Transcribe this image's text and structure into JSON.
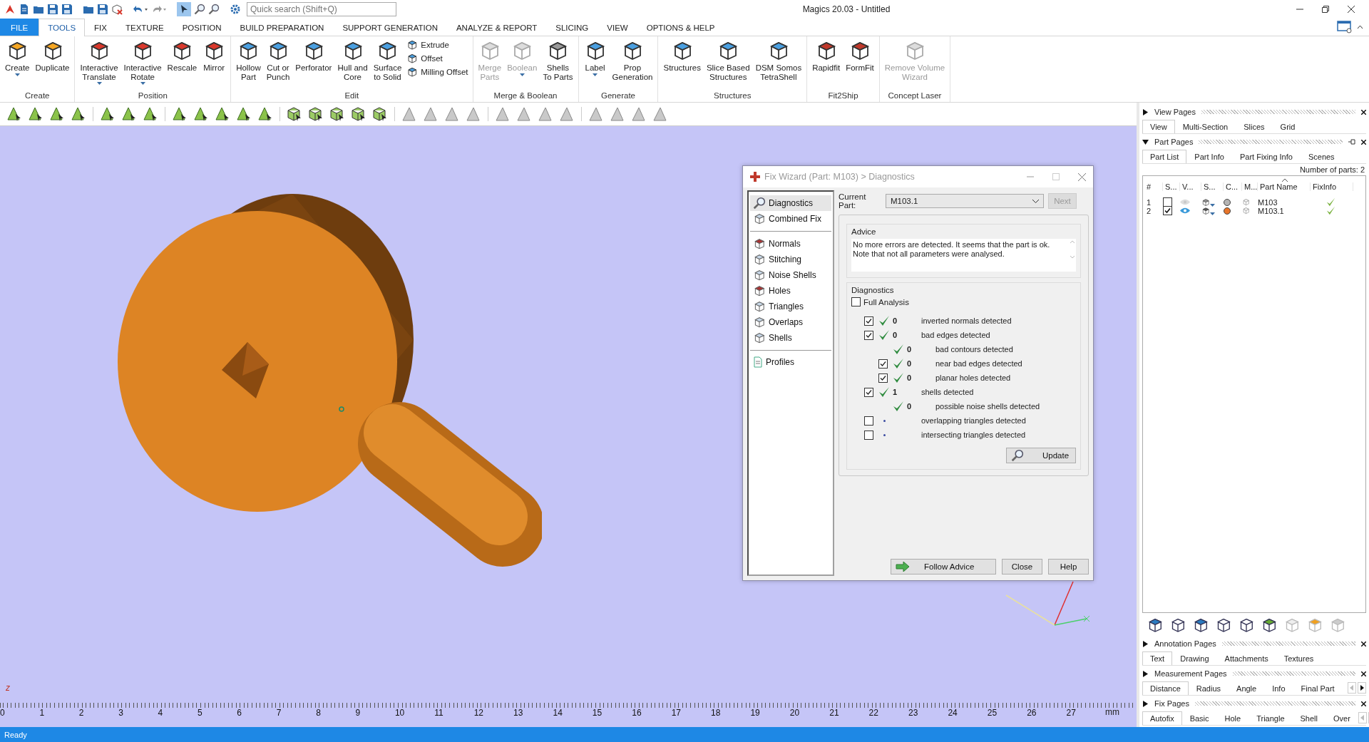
{
  "title_bar": {
    "search": {
      "placeholder": "Quick search (Shift+Q)"
    },
    "title": "Magics 20.03 - Untitled"
  },
  "menu_tabs": [
    {
      "label": "FILE",
      "kind": "file",
      "selected": false
    },
    {
      "label": "TOOLS",
      "kind": "tab",
      "selected": true
    },
    {
      "label": "FIX",
      "kind": "tab",
      "selected": false
    },
    {
      "label": "TEXTURE",
      "kind": "tab",
      "selected": false
    },
    {
      "label": "POSITION",
      "kind": "tab",
      "selected": false
    },
    {
      "label": "BUILD PREPARATION",
      "kind": "tab",
      "selected": false
    },
    {
      "label": "SUPPORT GENERATION",
      "kind": "tab",
      "selected": false
    },
    {
      "label": "ANALYZE & REPORT",
      "kind": "tab",
      "selected": false
    },
    {
      "label": "SLICING",
      "kind": "tab",
      "selected": false
    },
    {
      "label": "VIEW",
      "kind": "tab",
      "selected": false
    },
    {
      "label": "OPTIONS & HELP",
      "kind": "tab",
      "selected": false
    }
  ],
  "ribbon": {
    "groups": [
      {
        "label": "Create",
        "buttons": [
          {
            "label": "Create",
            "kind": "large",
            "dropdown": true,
            "disabled": false
          },
          {
            "label": "Duplicate",
            "kind": "large",
            "dropdown": false,
            "disabled": false
          }
        ]
      },
      {
        "label": "Position",
        "buttons": [
          {
            "label": "Interactive\nTranslate",
            "kind": "large",
            "dropdown": true,
            "disabled": false
          },
          {
            "label": "Interactive\nRotate",
            "kind": "large",
            "dropdown": true,
            "disabled": false
          },
          {
            "label": "Rescale",
            "kind": "large",
            "dropdown": false,
            "disabled": false
          },
          {
            "label": "Mirror",
            "kind": "large",
            "dropdown": false,
            "disabled": false
          }
        ]
      },
      {
        "label": "Edit",
        "buttons": [
          {
            "label": "Hollow\nPart",
            "kind": "large",
            "dropdown": false,
            "disabled": false
          },
          {
            "label": "Cut or\nPunch",
            "kind": "large",
            "dropdown": false,
            "disabled": false
          },
          {
            "label": "Perforator",
            "kind": "large",
            "dropdown": false,
            "disabled": false
          },
          {
            "label": "Hull and\nCore",
            "kind": "large",
            "dropdown": false,
            "disabled": false
          },
          {
            "label": "Surface\nto Solid",
            "kind": "large",
            "dropdown": false,
            "disabled": false
          },
          {
            "label": "Extrude",
            "kind": "small",
            "dropdown": false,
            "disabled": false
          },
          {
            "label": "Offset",
            "kind": "small",
            "dropdown": false,
            "disabled": false
          },
          {
            "label": "Milling Offset",
            "kind": "small",
            "dropdown": false,
            "disabled": false
          }
        ]
      },
      {
        "label": "Merge & Boolean",
        "buttons": [
          {
            "label": "Merge\nParts",
            "kind": "large",
            "dropdown": false,
            "disabled": true
          },
          {
            "label": "Boolean",
            "kind": "large",
            "dropdown": true,
            "disabled": true
          },
          {
            "label": "Shells\nTo Parts",
            "kind": "large",
            "dropdown": false,
            "disabled": false
          }
        ]
      },
      {
        "label": "Generate",
        "buttons": [
          {
            "label": "Label",
            "kind": "large",
            "dropdown": true,
            "disabled": false
          },
          {
            "label": "Prop\nGeneration",
            "kind": "large",
            "dropdown": false,
            "disabled": false
          }
        ]
      },
      {
        "label": "Structures",
        "buttons": [
          {
            "label": "Structures",
            "kind": "large",
            "dropdown": false,
            "disabled": false
          },
          {
            "label": "Slice Based\nStructures",
            "kind": "large",
            "dropdown": false,
            "disabled": false
          },
          {
            "label": "DSM Somos\nTetraShell",
            "kind": "large",
            "dropdown": false,
            "disabled": false
          }
        ]
      },
      {
        "label": "Fit2Ship",
        "buttons": [
          {
            "label": "Rapidfit",
            "kind": "large",
            "dropdown": false,
            "disabled": false
          },
          {
            "label": "FormFit",
            "kind": "large",
            "dropdown": false,
            "disabled": false
          }
        ]
      },
      {
        "label": "Concept Laser",
        "buttons": [
          {
            "label": "Remove Volume\nWizard",
            "kind": "large",
            "dropdown": false,
            "disabled": true
          }
        ]
      }
    ]
  },
  "viewport": {
    "axis_label": "z",
    "ruler": {
      "labels": [
        "0",
        "1",
        "2",
        "3",
        "4",
        "5",
        "6",
        "7",
        "8",
        "9",
        "10",
        "11",
        "12",
        "13",
        "14",
        "15",
        "16",
        "17",
        "18",
        "19",
        "20",
        "21",
        "22",
        "23",
        "24",
        "25",
        "26",
        "27"
      ],
      "unit": "mm"
    }
  },
  "fix_wizard": {
    "title": "Fix Wizard (Part: M103) > Diagnostics",
    "nav_groups": [
      {
        "items": [
          {
            "label": "Diagnostics",
            "selected": true
          },
          {
            "label": "Combined Fix",
            "selected": false
          }
        ]
      },
      {
        "items": [
          {
            "label": "Normals",
            "selected": false
          },
          {
            "label": "Stitching",
            "selected": false
          },
          {
            "label": "Noise Shells",
            "selected": false
          },
          {
            "label": "Holes",
            "selected": false
          },
          {
            "label": "Triangles",
            "selected": false
          },
          {
            "label": "Overlaps",
            "selected": false
          },
          {
            "label": "Shells",
            "selected": false
          }
        ]
      },
      {
        "items": [
          {
            "label": "Profiles",
            "selected": false
          }
        ]
      }
    ],
    "current_part": {
      "label": "Current Part:",
      "value": "M103.1"
    },
    "next_button": {
      "label": "Next",
      "disabled": true
    },
    "advice": {
      "title": "Advice",
      "text": "No more errors are detected. It seems that the part is ok.\nNote that not all parameters were analysed."
    },
    "diagnostics": {
      "title": "Diagnostics",
      "full_analysis": {
        "label": "Full Analysis",
        "checked": false
      },
      "checks": [
        {
          "kind": "check",
          "checked": true,
          "ok": true,
          "count": "0",
          "label": "inverted normals detected"
        },
        {
          "kind": "check",
          "checked": true,
          "ok": true,
          "count": "0",
          "label": "bad edges detected",
          "children": [
            {
              "kind": "plain",
              "ok": true,
              "count": "0",
              "label": "bad contours detected"
            },
            {
              "kind": "check",
              "checked": true,
              "ok": true,
              "count": "0",
              "label": "near bad edges detected"
            },
            {
              "kind": "check",
              "checked": true,
              "ok": true,
              "count": "0",
              "label": "planar holes detected"
            }
          ]
        },
        {
          "kind": "check",
          "checked": true,
          "ok": true,
          "count": "1",
          "label": "shells detected",
          "children": [
            {
              "kind": "plain",
              "ok": true,
              "count": "0",
              "label": "possible noise shells detected"
            }
          ]
        },
        {
          "kind": "check",
          "checked": false,
          "ok": false,
          "label": "overlapping triangles detected"
        },
        {
          "kind": "check",
          "checked": false,
          "ok": false,
          "label": "intersecting triangles detected"
        }
      ]
    },
    "update_button": "Update",
    "buttons": [
      "Follow Advice",
      "Close",
      "Help"
    ]
  },
  "panel_sections": [
    {
      "kind": "tabs",
      "title": "View Pages",
      "expanded": false,
      "scrollable": false,
      "tabs": [
        {
          "label": "View",
          "selected": true
        },
        {
          "label": "Multi-Section",
          "selected": false
        },
        {
          "label": "Slices",
          "selected": false
        },
        {
          "label": "Grid",
          "selected": false
        }
      ]
    },
    {
      "kind": "part_list",
      "title": "Part Pages",
      "expanded": true,
      "scrollable": false,
      "tabs": [
        {
          "label": "Part List",
          "selected": true
        },
        {
          "label": "Part Info",
          "selected": false
        },
        {
          "label": "Part Fixing Info",
          "selected": false
        },
        {
          "label": "Scenes",
          "selected": false
        }
      ],
      "parts_count": "Number of parts: 2",
      "columns": [
        "#",
        "S...",
        "V...",
        "S...",
        "C...",
        "M...",
        "Part Name",
        "FixInfo"
      ],
      "rows": [
        {
          "number": "1",
          "checked": false,
          "visible": false,
          "color": "#b4b4b4",
          "name": "M103",
          "fix_ok": true
        },
        {
          "number": "2",
          "checked": true,
          "visible": true,
          "color": "#e8752a",
          "name": "M103.1",
          "fix_ok": true
        }
      ]
    },
    {
      "kind": "tabs",
      "title": "Annotation Pages",
      "expanded": false,
      "scrollable": false,
      "tabs": [
        {
          "label": "Text",
          "selected": true
        },
        {
          "label": "Drawing",
          "selected": false
        },
        {
          "label": "Attachments",
          "selected": false
        },
        {
          "label": "Textures",
          "selected": false
        }
      ]
    },
    {
      "kind": "tabs",
      "title": "Measurement Pages",
      "expanded": false,
      "scrollable": true,
      "tabs": [
        {
          "label": "Distance",
          "selected": true
        },
        {
          "label": "Radius",
          "selected": false
        },
        {
          "label": "Angle",
          "selected": false
        },
        {
          "label": "Info",
          "selected": false
        },
        {
          "label": "Final Part",
          "selected": false
        }
      ]
    },
    {
      "kind": "tabs",
      "title": "Fix Pages",
      "expanded": false,
      "scrollable": true,
      "tabs": [
        {
          "label": "Autofix",
          "selected": true
        },
        {
          "label": "Basic",
          "selected": false
        },
        {
          "label": "Hole",
          "selected": false
        },
        {
          "label": "Triangle",
          "selected": false
        },
        {
          "label": "Shell",
          "selected": false
        },
        {
          "label": "Over",
          "selected": false
        }
      ]
    }
  ],
  "status_bar": {
    "text": "Ready"
  }
}
